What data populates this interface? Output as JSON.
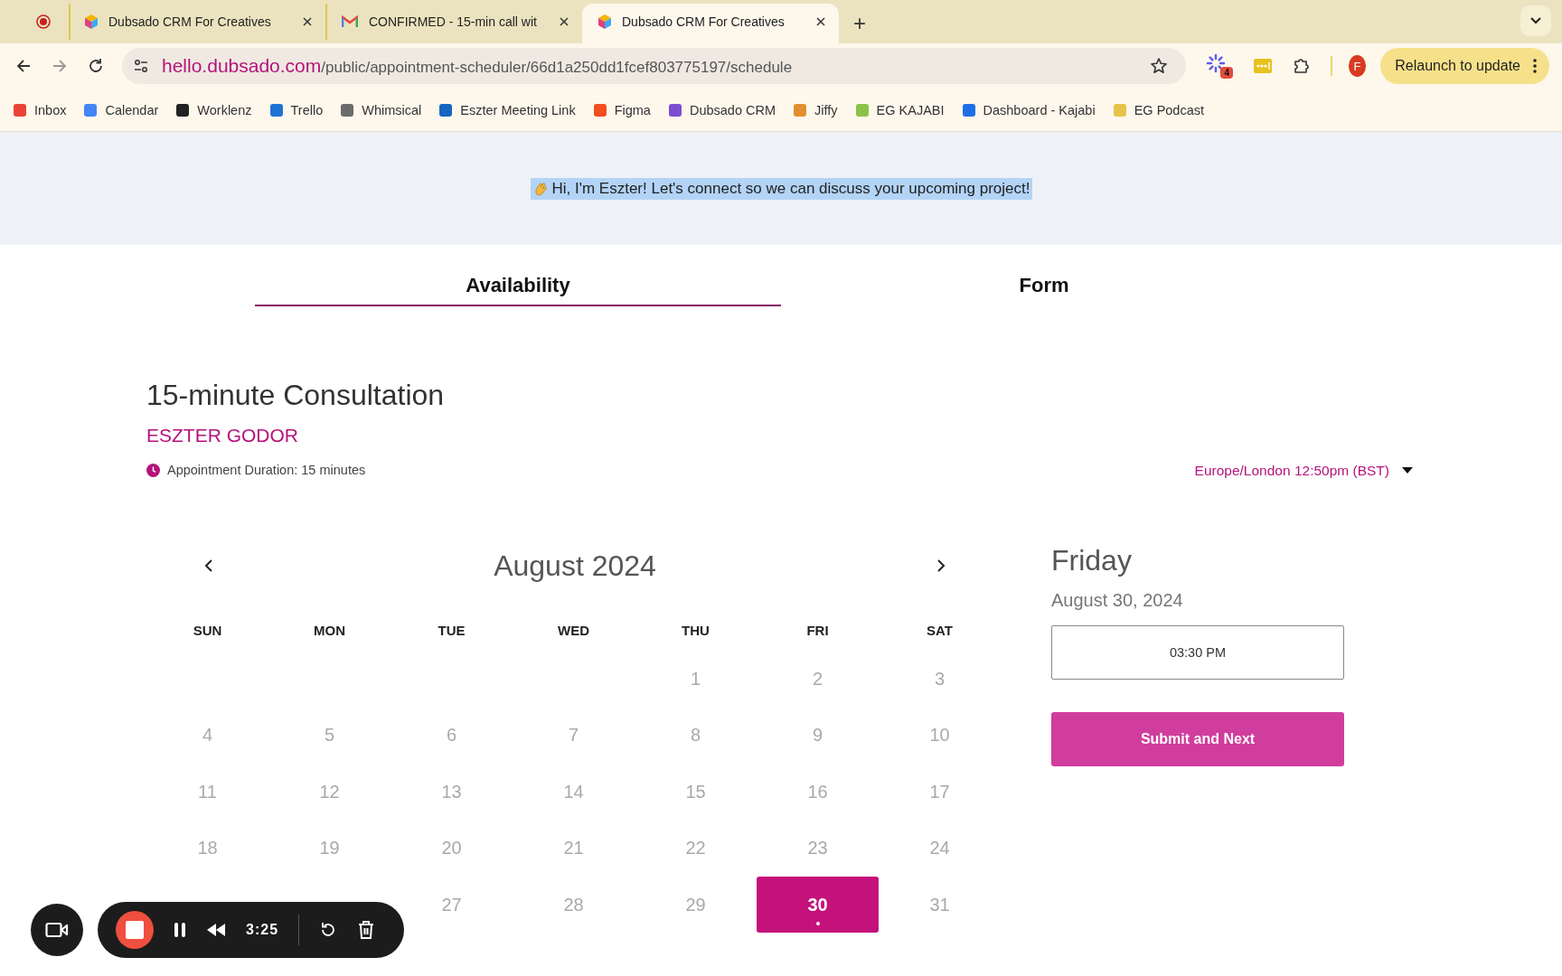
{
  "browser": {
    "tabs": [
      {
        "kind": "recording",
        "selected": false
      },
      {
        "kind": "dubsado",
        "title": "Dubsado CRM For Creatives",
        "selected": false
      },
      {
        "kind": "gmail",
        "title": "CONFIRMED - 15-min call wit",
        "selected": false
      },
      {
        "kind": "dubsado",
        "title": "Dubsado CRM For Creatives",
        "selected": true
      }
    ],
    "new_tab": "+",
    "url_host": "hello.dubsado.com",
    "url_path": "/public/appointment-scheduler/66d1a250dd1fcef803775197/schedule",
    "extension_badge": "4",
    "profile": "F",
    "relaunch": "Relaunch to update",
    "bookmarks": [
      {
        "label": "Inbox",
        "color": "#ea4335"
      },
      {
        "label": "Calendar",
        "color": "#4285f4"
      },
      {
        "label": "Worklenz",
        "color": "#222222"
      },
      {
        "label": "Trello",
        "color": "#1f73d6"
      },
      {
        "label": "Whimsical",
        "color": "#6b6b6b"
      },
      {
        "label": "Eszter Meeting Link",
        "color": "#1565c0"
      },
      {
        "label": "Figma",
        "color": "#f24e1e"
      },
      {
        "label": "Dubsado CRM",
        "color": "#7c4dd1"
      },
      {
        "label": "Jiffy",
        "color": "#e0902e"
      },
      {
        "label": "EG KAJABI",
        "color": "#8bc34a"
      },
      {
        "label": "Dashboard - Kajabi",
        "color": "#1e6ee8"
      },
      {
        "label": "EG Podcast",
        "color": "#e7c34a"
      }
    ]
  },
  "banner": {
    "text": "Hi, I'm Eszter! Let's connect so we can discuss your upcoming project!"
  },
  "page_tabs": [
    {
      "label": "Availability",
      "selected": true
    },
    {
      "label": "Form",
      "selected": false
    }
  ],
  "event": {
    "title": "15-minute Consultation",
    "host": "ESZTER GODOR",
    "duration": "Appointment Duration: 15 minutes"
  },
  "timezone": "Europe/London 12:50pm (BST)",
  "calendar": {
    "month": "August 2024",
    "weekdays": [
      "SUN",
      "MON",
      "TUE",
      "WED",
      "THU",
      "FRI",
      "SAT"
    ],
    "weeks": [
      [
        {
          "kind": "blank"
        },
        {
          "kind": "blank"
        },
        {
          "kind": "blank"
        },
        {
          "kind": "blank"
        },
        {
          "kind": "day",
          "label": "1",
          "selected": false
        },
        {
          "kind": "day",
          "label": "2",
          "selected": false
        },
        {
          "kind": "day",
          "label": "3",
          "selected": false
        }
      ],
      [
        {
          "kind": "day",
          "label": "4",
          "selected": false
        },
        {
          "kind": "day",
          "label": "5",
          "selected": false
        },
        {
          "kind": "day",
          "label": "6",
          "selected": false
        },
        {
          "kind": "day",
          "label": "7",
          "selected": false
        },
        {
          "kind": "day",
          "label": "8",
          "selected": false
        },
        {
          "kind": "day",
          "label": "9",
          "selected": false
        },
        {
          "kind": "day",
          "label": "10",
          "selected": false
        }
      ],
      [
        {
          "kind": "day",
          "label": "11",
          "selected": false
        },
        {
          "kind": "day",
          "label": "12",
          "selected": false
        },
        {
          "kind": "day",
          "label": "13",
          "selected": false
        },
        {
          "kind": "day",
          "label": "14",
          "selected": false
        },
        {
          "kind": "day",
          "label": "15",
          "selected": false
        },
        {
          "kind": "day",
          "label": "16",
          "selected": false
        },
        {
          "kind": "day",
          "label": "17",
          "selected": false
        }
      ],
      [
        {
          "kind": "day",
          "label": "18",
          "selected": false
        },
        {
          "kind": "day",
          "label": "19",
          "selected": false
        },
        {
          "kind": "day",
          "label": "20",
          "selected": false
        },
        {
          "kind": "day",
          "label": "21",
          "selected": false
        },
        {
          "kind": "day",
          "label": "22",
          "selected": false
        },
        {
          "kind": "day",
          "label": "23",
          "selected": false
        },
        {
          "kind": "day",
          "label": "24",
          "selected": false
        }
      ],
      [
        {
          "kind": "blank"
        },
        {
          "kind": "blank"
        },
        {
          "kind": "day",
          "label": "27",
          "selected": false
        },
        {
          "kind": "day",
          "label": "28",
          "selected": false
        },
        {
          "kind": "day",
          "label": "29",
          "selected": false
        },
        {
          "kind": "day",
          "label": "30",
          "selected": true
        },
        {
          "kind": "day",
          "label": "31",
          "selected": false
        }
      ]
    ]
  },
  "day_panel": {
    "weekday": "Friday",
    "date": "August 30, 2024",
    "slots": [
      {
        "label": "03:30 PM"
      }
    ],
    "submit": "Submit and Next"
  },
  "recorder": {
    "time": "3:25"
  }
}
